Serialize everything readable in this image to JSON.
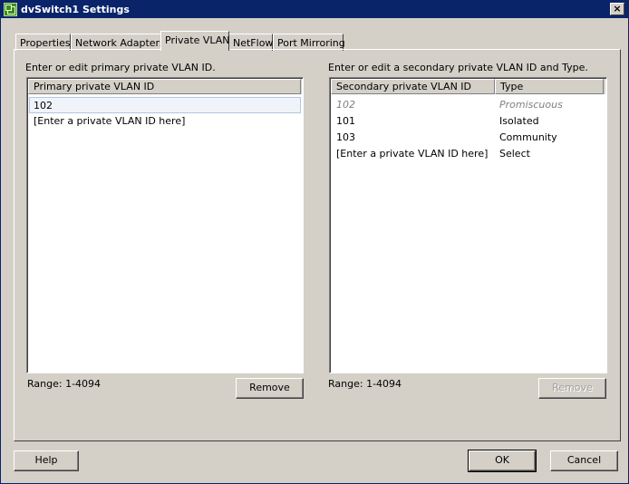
{
  "window": {
    "title": "dvSwitch1 Settings",
    "close_glyph": "×"
  },
  "tabs": [
    {
      "label": "Properties",
      "active": false
    },
    {
      "label": "Network Adapters",
      "active": false
    },
    {
      "label": "Private VLAN",
      "active": true
    },
    {
      "label": "NetFlow",
      "active": false
    },
    {
      "label": "Port Mirroring",
      "active": false
    }
  ],
  "primary": {
    "instruction": "Enter or edit primary private VLAN ID.",
    "column": "Primary private VLAN ID",
    "rows": [
      "102",
      "[Enter a private VLAN ID here]"
    ],
    "range": "Range: 1-4094",
    "remove_label": "Remove"
  },
  "secondary": {
    "instruction": "Enter or edit a secondary private VLAN ID and Type.",
    "columns": [
      "Secondary private VLAN ID",
      "Type"
    ],
    "rows": [
      {
        "id": "102",
        "type": "Promiscuous"
      },
      {
        "id": "101",
        "type": "Isolated"
      },
      {
        "id": "103",
        "type": "Community"
      },
      {
        "id": "[Enter a private VLAN ID here]",
        "type": "Select"
      }
    ],
    "range": "Range: 1-4094",
    "remove_label": "Remove"
  },
  "footer": {
    "help_label": "Help",
    "ok_label": "OK",
    "cancel_label": "Cancel"
  }
}
